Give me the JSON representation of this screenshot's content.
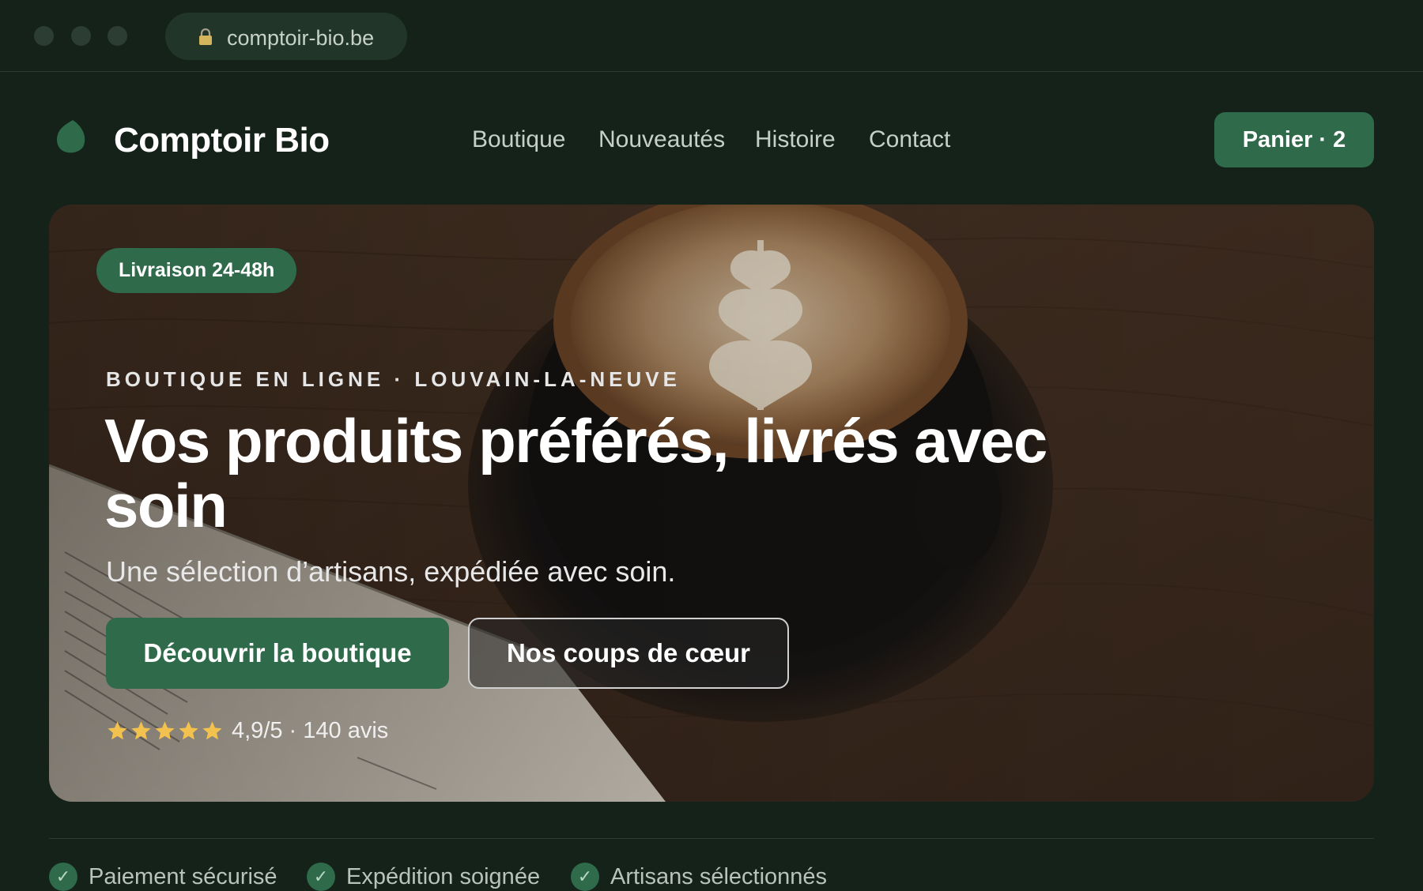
{
  "browser": {
    "url": "comptoir-bio.be",
    "lock_icon": "lock-icon"
  },
  "header": {
    "brand": "Comptoir Bio",
    "logo_icon": "leaf-icon",
    "nav": [
      "Boutique",
      "Nouveautés",
      "Histoire",
      "Contact"
    ],
    "cart_label": "Panier · 2"
  },
  "hero": {
    "badge": "Livraison 24-48h",
    "eyebrow": "BOUTIQUE EN LIGNE · LOUVAIN-LA-NEUVE",
    "headline": "Vos produits préférés, livrés avec soin",
    "subtitle": "Une sélection d’artisans, expédiée avec soin.",
    "cta_primary": "Découvrir la boutique",
    "cta_secondary": "Nos coups de cœur",
    "rating": {
      "stars": 5,
      "text": "4,9/5 · 140 avis"
    }
  },
  "trust": [
    "Paiement sécurisé",
    "Expédition soignée",
    "Artisans sélectionnés"
  ],
  "colors": {
    "background": "#142219",
    "accent": "#2f6a4b",
    "star": "#f2c14e",
    "text": "#ffffff",
    "nav_text": "#c4d0c9"
  }
}
